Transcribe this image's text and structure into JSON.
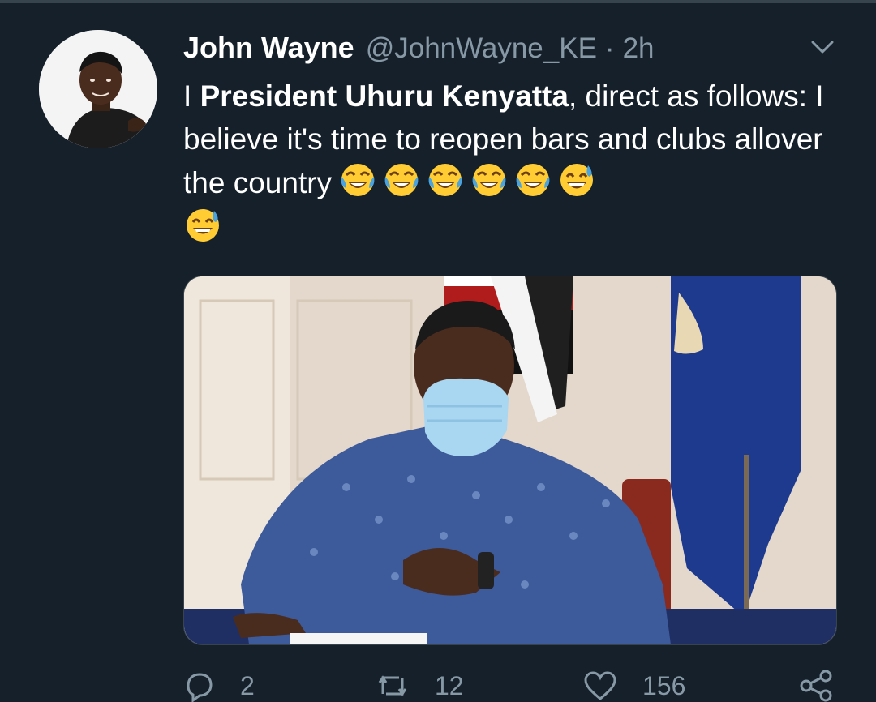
{
  "tweet": {
    "display_name": "John Wayne",
    "handle": "@JohnWayne_KE",
    "separator": "·",
    "time": "2h",
    "text_prefix": "I ",
    "text_bold": "President Uhuru Kenyatta",
    "text_rest": ", direct as follows: I believe it's time to reopen bars and clubs allover the country",
    "emojis": [
      "face-with-tears-of-joy",
      "face-with-tears-of-joy",
      "face-with-tears-of-joy",
      "face-with-tears-of-joy",
      "face-with-tears-of-joy",
      "grinning-face-with-sweat",
      "grinning-face-with-sweat"
    ]
  },
  "actions": {
    "reply_count": "2",
    "retweet_count": "12",
    "like_count": "156"
  },
  "icons": {
    "caret": "chevron-down-icon",
    "reply": "reply-icon",
    "retweet": "retweet-icon",
    "like": "heart-icon",
    "share": "share-icon"
  },
  "colors": {
    "background": "#15202b",
    "secondary_text": "#8899a6",
    "divider": "#38444d"
  }
}
